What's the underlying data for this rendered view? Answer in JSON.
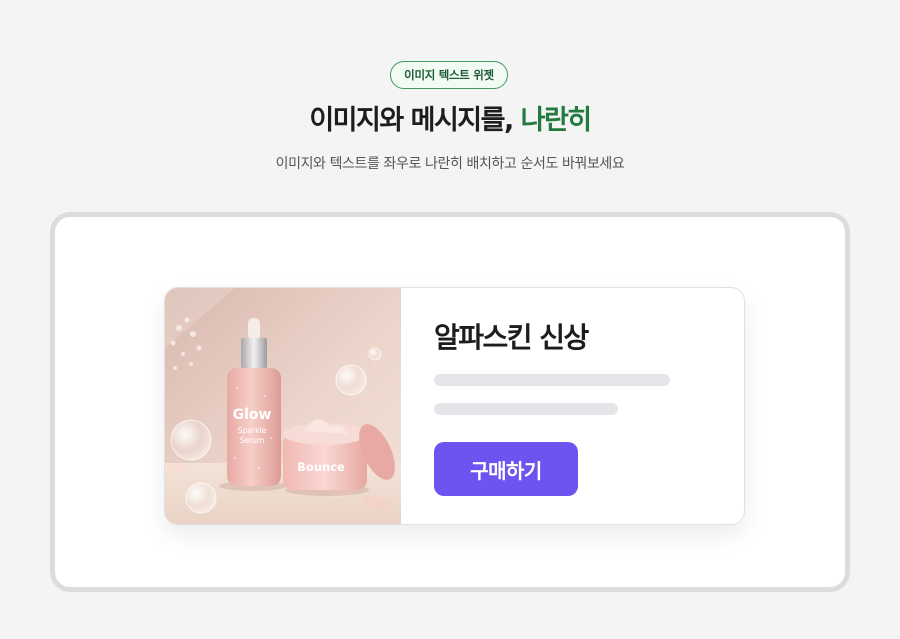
{
  "badge": {
    "label": "이미지 텍스트 위젯"
  },
  "headline": {
    "main": "이미지와 메시지를, ",
    "accent": "나란히"
  },
  "subtitle": "이미지와 텍스트를 좌우로 나란히 배치하고 순서도 바꿔보세요",
  "card": {
    "image": {
      "serum_brand": "Glow",
      "serum_line1": "Sparkle",
      "serum_line2": "Serum",
      "cream_brand": "Bounce"
    },
    "title": "알파스킨 신상",
    "button_label": "구매하기"
  },
  "colors": {
    "accent_green": "#237a3f",
    "button_purple": "#6c54f0",
    "badge_border": "#3f9b5b"
  }
}
